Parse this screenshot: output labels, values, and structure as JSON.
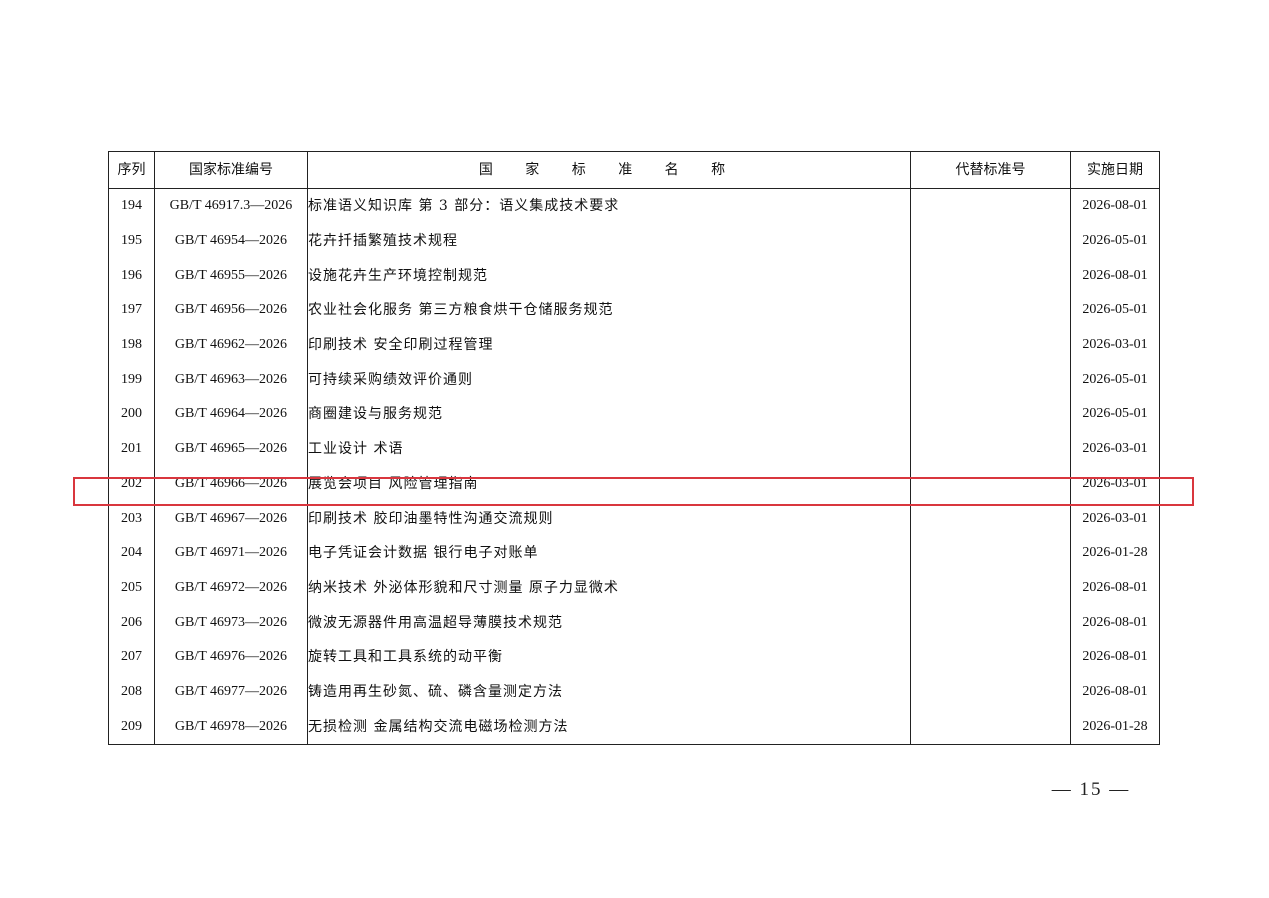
{
  "table": {
    "headers": {
      "seq": "序列",
      "code": "国家标准编号",
      "name": "国 家 标 准 名 称",
      "replaced": "代替标准号",
      "date": "实施日期"
    },
    "rows": [
      {
        "seq": "194",
        "code": "GB/T 46917.3—2026",
        "name": "标准语义知识库 第 3 部分：语义集成技术要求",
        "replaced": "",
        "date": "2026-08-01"
      },
      {
        "seq": "195",
        "code": "GB/T 46954—2026",
        "name": "花卉扦插繁殖技术规程",
        "replaced": "",
        "date": "2026-05-01"
      },
      {
        "seq": "196",
        "code": "GB/T 46955—2026",
        "name": "设施花卉生产环境控制规范",
        "replaced": "",
        "date": "2026-08-01"
      },
      {
        "seq": "197",
        "code": "GB/T 46956—2026",
        "name": "农业社会化服务 第三方粮食烘干仓储服务规范",
        "replaced": "",
        "date": "2026-05-01"
      },
      {
        "seq": "198",
        "code": "GB/T 46962—2026",
        "name": "印刷技术 安全印刷过程管理",
        "replaced": "",
        "date": "2026-03-01"
      },
      {
        "seq": "199",
        "code": "GB/T 46963—2026",
        "name": "可持续采购绩效评价通则",
        "replaced": "",
        "date": "2026-05-01"
      },
      {
        "seq": "200",
        "code": "GB/T 46964—2026",
        "name": "商圈建设与服务规范",
        "replaced": "",
        "date": "2026-05-01"
      },
      {
        "seq": "201",
        "code": "GB/T 46965—2026",
        "name": "工业设计 术语",
        "replaced": "",
        "date": "2026-03-01"
      },
      {
        "seq": "202",
        "code": "GB/T 46966—2026",
        "name": "展览会项目 风险管理指南",
        "replaced": "",
        "date": "2026-03-01"
      },
      {
        "seq": "203",
        "code": "GB/T 46967—2026",
        "name": "印刷技术 胶印油墨特性沟通交流规则",
        "replaced": "",
        "date": "2026-03-01"
      },
      {
        "seq": "204",
        "code": "GB/T 46971—2026",
        "name": "电子凭证会计数据 银行电子对账单",
        "replaced": "",
        "date": "2026-01-28"
      },
      {
        "seq": "205",
        "code": "GB/T 46972—2026",
        "name": "纳米技术 外泌体形貌和尺寸测量 原子力显微术",
        "replaced": "",
        "date": "2026-08-01"
      },
      {
        "seq": "206",
        "code": "GB/T 46973—2026",
        "name": "微波无源器件用高温超导薄膜技术规范",
        "replaced": "",
        "date": "2026-08-01"
      },
      {
        "seq": "207",
        "code": "GB/T 46976—2026",
        "name": "旋转工具和工具系统的动平衡",
        "replaced": "",
        "date": "2026-08-01"
      },
      {
        "seq": "208",
        "code": "GB/T 46977—2026",
        "name": "铸造用再生砂氮、硫、磷含量测定方法",
        "replaced": "",
        "date": "2026-08-01"
      },
      {
        "seq": "209",
        "code": "GB/T 46978—2026",
        "name": "无损检测 金属结构交流电磁场检测方法",
        "replaced": "",
        "date": "2026-01-28"
      }
    ]
  },
  "highlight": {
    "row_seq": "202",
    "color": "#d9363e"
  },
  "footer": {
    "page_number": "— 15 —"
  }
}
